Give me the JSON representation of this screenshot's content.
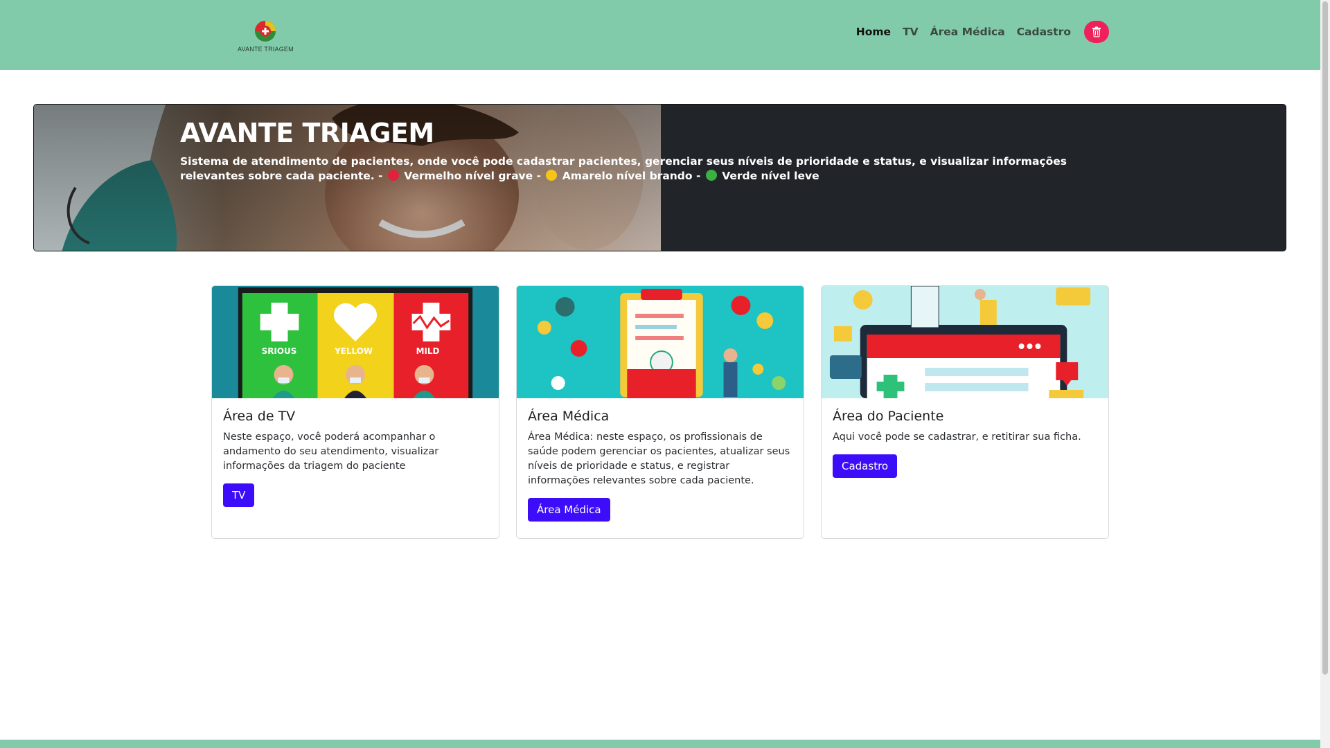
{
  "brand": {
    "logo_text": "AVANTE TRIAGEM"
  },
  "nav": {
    "items": [
      {
        "label": "Home",
        "active": true
      },
      {
        "label": "TV",
        "active": false
      },
      {
        "label": "Área Médica",
        "active": false
      },
      {
        "label": "Cadastro",
        "active": false
      }
    ],
    "trash_icon": "trash-icon"
  },
  "hero": {
    "title": "AVANTE TRIAGEM",
    "desc_start": "Sistema de atendimento de pacientes, onde você pode cadastrar pacientes, gerenciar seus níveis de prioridade e status, e visualizar informações relevantes sobre cada paciente. - ",
    "red": "Vermelho nível grave - ",
    "yellow": "Amarelo nível brando - ",
    "green": "Verde nível leve"
  },
  "cards": [
    {
      "title": "Área de TV",
      "text": "Neste espaço, você poderá acompanhar o andamento do seu atendimento, visualizar informações da triagem do paciente",
      "button": "TV",
      "image_labels": [
        "SRIOUS",
        "YELLOW",
        "MILD"
      ]
    },
    {
      "title": "Área Médica",
      "text": "Área Médica: neste espaço, os profissionais de saúde podem gerenciar os pacientes, atualizar seus níveis de prioridade e status, e registrar informações relevantes sobre cada paciente.",
      "button": "Área Médica"
    },
    {
      "title": "Área do Paciente",
      "text": "Aqui você pode se cadastrar, e retitirar sua ficha.",
      "button": "Cadastro"
    }
  ],
  "colors": {
    "header": "#81cbab",
    "button": "#3d0dfa",
    "trash": "#f0205a",
    "hero_bg": "#212529"
  }
}
